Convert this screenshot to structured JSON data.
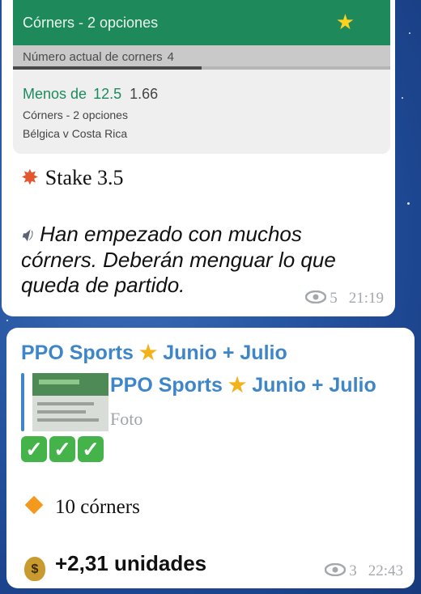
{
  "colors": {
    "green_header": "#1e8a5c",
    "link_blue": "#3f86c8",
    "meta_gray": "#a3a8ae",
    "star_gold": "#f3b21a"
  },
  "preview": {
    "header_title": "Córners - 2 opciones",
    "star_icon": "star-icon",
    "bar_label": "Número actual de corners",
    "bar_value": "4",
    "progress_fraction": 0.5,
    "bet_label": "Menos de",
    "bet_value": "12.5",
    "bet_odds": "1.66",
    "market": "Córners - 2 opciones",
    "match": "Bélgica v Costa Rica"
  },
  "message1": {
    "stake_text": "Stake 3.5",
    "body_text": "Han empezado con muchos córners. Deberán menguar lo que queda de partido.",
    "views": "5",
    "time": "21:19"
  },
  "message2": {
    "sender": "PPO Sports",
    "sender_suffix": "Junio + Julio",
    "quote_sender": "PPO Sports",
    "quote_suffix": "Junio + Julio",
    "quote_type": "Foto",
    "corners_text": "10 córners",
    "units_text": "+2,31 unidades",
    "views": "3",
    "time": "22:43"
  }
}
